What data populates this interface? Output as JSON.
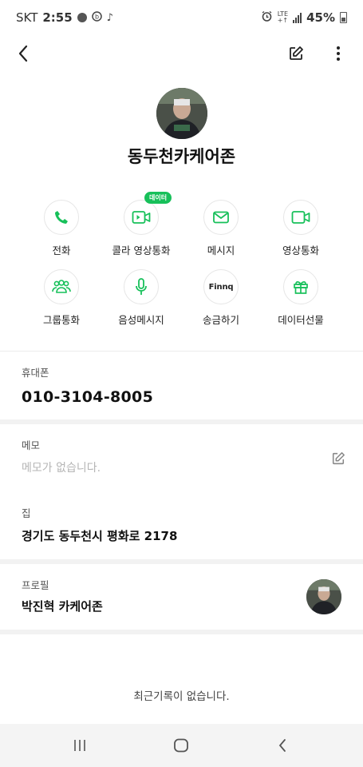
{
  "status": {
    "carrier": "SKT",
    "time": "2:55",
    "lte_top": "LTE",
    "lte_bottom": "+↑",
    "battery": "45%"
  },
  "contact": {
    "name": "동두천카케어존"
  },
  "actions": [
    {
      "label": "전화",
      "icon": "phone-icon"
    },
    {
      "label": "콜라 영상통화",
      "icon": "video-call-icon",
      "badge": "데이터"
    },
    {
      "label": "메시지",
      "icon": "message-icon"
    },
    {
      "label": "영상통화",
      "icon": "video-icon"
    },
    {
      "label": "그룹통화",
      "icon": "group-icon"
    },
    {
      "label": "음성메시지",
      "icon": "mic-icon"
    },
    {
      "label": "송금하기",
      "icon": "finnq-logo",
      "logo_text": "Finnq"
    },
    {
      "label": "데이터선물",
      "icon": "gift-icon"
    }
  ],
  "fields": {
    "phone_label": "휴대폰",
    "phone_value": "010-3104-8005",
    "memo_label": "메모",
    "memo_placeholder": "메모가 없습니다.",
    "home_label": "집",
    "home_value": "경기도 동두천시 평화로 2178",
    "profile_label": "프로필",
    "profile_value": "박진혁 카케어존"
  },
  "recent": {
    "empty_text": "최근기록이 없습니다."
  },
  "colors": {
    "accent": "#17c05a",
    "icon_dark": "#333333"
  }
}
